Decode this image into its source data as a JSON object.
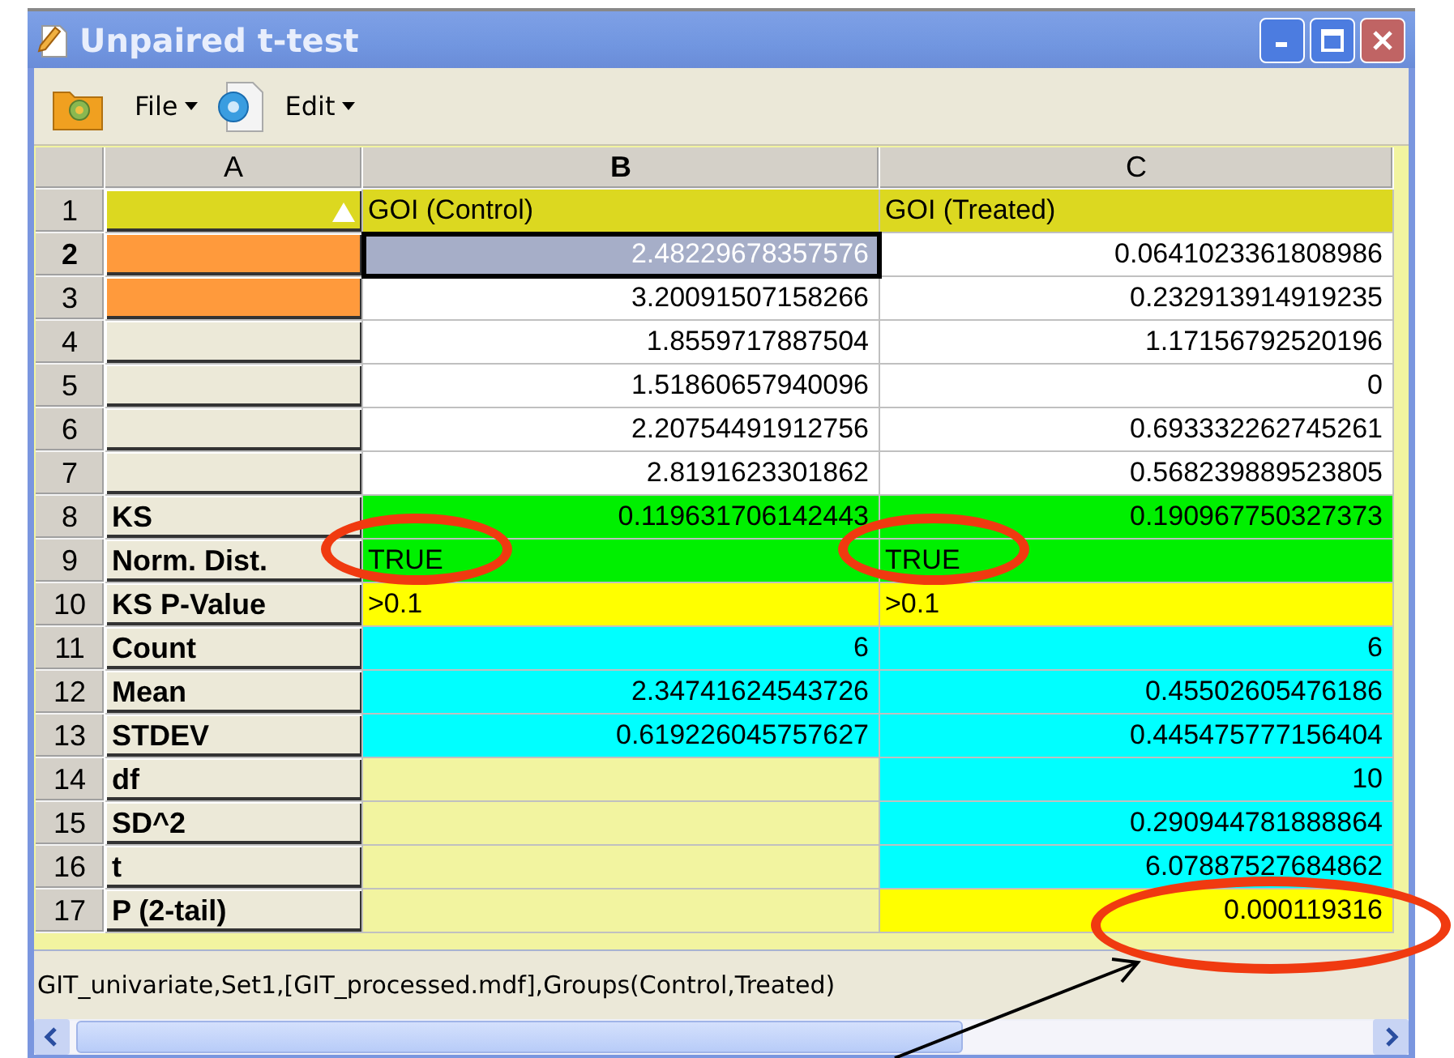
{
  "window": {
    "title": "Unpaired t-test"
  },
  "toolbar": {
    "menus": [
      "File",
      "Edit"
    ]
  },
  "columns": [
    {
      "label": "A",
      "selected": false
    },
    {
      "label": "B",
      "selected": true
    },
    {
      "label": "C",
      "selected": false
    }
  ],
  "rows": [
    {
      "header": "1",
      "selected": false,
      "cells": [
        {
          "kind": "label",
          "color": "#dcd820",
          "sorted": true,
          "selected": false
        },
        {
          "kind": "text",
          "text": "GOI (Control)",
          "color": "#dcd820",
          "selected": false,
          "circled": false
        },
        {
          "kind": "text",
          "text": "GOI (Treated)",
          "color": "#dcd820",
          "selected": false,
          "circled": false
        }
      ]
    },
    {
      "header": "2",
      "selected": true,
      "cells": [
        {
          "kind": "label",
          "color": "#ff9a3c",
          "sorted": false,
          "selected": false
        },
        {
          "kind": "number",
          "text": "2.48229678357576",
          "color": "#a6aec8",
          "selected": true,
          "circled": false
        },
        {
          "kind": "number",
          "text": "0.0641023361808986",
          "color": "#ffffff",
          "selected": false,
          "circled": false
        }
      ]
    },
    {
      "header": "3",
      "selected": false,
      "cells": [
        {
          "kind": "label",
          "color": "#ff9a3c",
          "sorted": false,
          "selected": false
        },
        {
          "kind": "number",
          "text": "3.20091507158266",
          "color": "#ffffff",
          "selected": false,
          "circled": false
        },
        {
          "kind": "number",
          "text": "0.232913914919235",
          "color": "#ffffff",
          "selected": false,
          "circled": false
        }
      ]
    },
    {
      "header": "4",
      "selected": false,
      "cells": [
        {
          "kind": "label",
          "color": "#ece9d8",
          "sorted": false,
          "selected": false
        },
        {
          "kind": "number",
          "text": "1.8559717887504",
          "color": "#ffffff",
          "selected": false,
          "circled": false
        },
        {
          "kind": "number",
          "text": "1.17156792520196",
          "color": "#ffffff",
          "selected": false,
          "circled": false
        }
      ]
    },
    {
      "header": "5",
      "selected": false,
      "cells": [
        {
          "kind": "label",
          "color": "#ece9d8",
          "sorted": false,
          "selected": false
        },
        {
          "kind": "number",
          "text": "1.51860657940096",
          "color": "#ffffff",
          "selected": false,
          "circled": false
        },
        {
          "kind": "number",
          "text": "0",
          "color": "#ffffff",
          "selected": false,
          "circled": false
        }
      ]
    },
    {
      "header": "6",
      "selected": false,
      "cells": [
        {
          "kind": "label",
          "color": "#ece9d8",
          "sorted": false,
          "selected": false
        },
        {
          "kind": "number",
          "text": "2.20754491912756",
          "color": "#ffffff",
          "selected": false,
          "circled": false
        },
        {
          "kind": "number",
          "text": "0.693332262745261",
          "color": "#ffffff",
          "selected": false,
          "circled": false
        }
      ]
    },
    {
      "header": "7",
      "selected": false,
      "cells": [
        {
          "kind": "label",
          "color": "#ece9d8",
          "sorted": false,
          "selected": false
        },
        {
          "kind": "number",
          "text": "2.8191623301862",
          "color": "#ffffff",
          "selected": false,
          "circled": false
        },
        {
          "kind": "number",
          "text": "0.568239889523805",
          "color": "#ffffff",
          "selected": false,
          "circled": false
        }
      ]
    },
    {
      "header": "8",
      "selected": false,
      "cells": [
        {
          "kind": "label",
          "text": "KS",
          "color": "#ece9d8",
          "sorted": false,
          "selected": false
        },
        {
          "kind": "number",
          "text": "0.119631706142443",
          "color": "#00f000",
          "selected": false,
          "circled": false
        },
        {
          "kind": "number",
          "text": "0.190967750327373",
          "color": "#00f000",
          "selected": false,
          "circled": false
        }
      ]
    },
    {
      "header": "9",
      "selected": false,
      "cells": [
        {
          "kind": "label",
          "text": "Norm. Dist.",
          "color": "#ece9d8",
          "sorted": false,
          "selected": false
        },
        {
          "kind": "text",
          "text": "TRUE",
          "color": "#00f000",
          "selected": false,
          "circled": true
        },
        {
          "kind": "text",
          "text": "TRUE",
          "color": "#00f000",
          "selected": false,
          "circled": true
        }
      ]
    },
    {
      "header": "10",
      "selected": false,
      "cells": [
        {
          "kind": "label",
          "text": "KS P-Value",
          "color": "#ece9d8",
          "sorted": false,
          "selected": false
        },
        {
          "kind": "text",
          "text": ">0.1",
          "color": "#ffff00",
          "selected": false,
          "circled": false
        },
        {
          "kind": "text",
          "text": ">0.1",
          "color": "#ffff00",
          "selected": false,
          "circled": false
        }
      ]
    },
    {
      "header": "11",
      "selected": false,
      "cells": [
        {
          "kind": "label",
          "text": "Count",
          "color": "#ece9d8",
          "sorted": false,
          "selected": false
        },
        {
          "kind": "number",
          "text": "6",
          "color": "#00ffff",
          "selected": false,
          "circled": false
        },
        {
          "kind": "number",
          "text": "6",
          "color": "#00ffff",
          "selected": false,
          "circled": false
        }
      ]
    },
    {
      "header": "12",
      "selected": false,
      "cells": [
        {
          "kind": "label",
          "text": "Mean",
          "color": "#ece9d8",
          "sorted": false,
          "selected": false
        },
        {
          "kind": "number",
          "text": "2.34741624543726",
          "color": "#00ffff",
          "selected": false,
          "circled": false
        },
        {
          "kind": "number",
          "text": "0.45502605476186",
          "color": "#00ffff",
          "selected": false,
          "circled": false
        }
      ]
    },
    {
      "header": "13",
      "selected": false,
      "cells": [
        {
          "kind": "label",
          "text": "STDEV",
          "color": "#ece9d8",
          "sorted": false,
          "selected": false
        },
        {
          "kind": "number",
          "text": "0.619226045757627",
          "color": "#00ffff",
          "selected": false,
          "circled": false
        },
        {
          "kind": "number",
          "text": "0.445475777156404",
          "color": "#00ffff",
          "selected": false,
          "circled": false
        }
      ]
    },
    {
      "header": "14",
      "selected": false,
      "cells": [
        {
          "kind": "label",
          "text": "df",
          "color": "#ece9d8",
          "sorted": false,
          "selected": false
        },
        {
          "kind": "number",
          "color": "#f2f4a0",
          "selected": false,
          "circled": false
        },
        {
          "kind": "number",
          "text": "10",
          "color": "#00ffff",
          "selected": false,
          "circled": false
        }
      ]
    },
    {
      "header": "15",
      "selected": false,
      "cells": [
        {
          "kind": "label",
          "text": "SD^2",
          "color": "#ece9d8",
          "sorted": false,
          "selected": false
        },
        {
          "kind": "number",
          "color": "#f2f4a0",
          "selected": false,
          "circled": false
        },
        {
          "kind": "number",
          "text": "0.290944781888864",
          "color": "#00ffff",
          "selected": false,
          "circled": false
        }
      ]
    },
    {
      "header": "16",
      "selected": false,
      "cells": [
        {
          "kind": "label",
          "text": "t",
          "color": "#ece9d8",
          "sorted": false,
          "selected": false
        },
        {
          "kind": "number",
          "color": "#f2f4a0",
          "selected": false,
          "circled": false
        },
        {
          "kind": "number",
          "text": "6.07887527684862",
          "color": "#00ffff",
          "selected": false,
          "circled": false
        }
      ]
    },
    {
      "header": "17",
      "selected": false,
      "cells": [
        {
          "kind": "label",
          "text": "P (2-tail)",
          "color": "#ece9d8",
          "sorted": false,
          "selected": false
        },
        {
          "kind": "number",
          "color": "#f2f4a0",
          "selected": false,
          "circled": false
        },
        {
          "kind": "number",
          "text": "0.000119316",
          "color": "#ffff00",
          "selected": false,
          "circled": true,
          "pointed": true
        }
      ]
    }
  ],
  "status_bar": "GIT_univariate,Set1,[GIT_processed.mdf],Groups(Control,Treated)"
}
